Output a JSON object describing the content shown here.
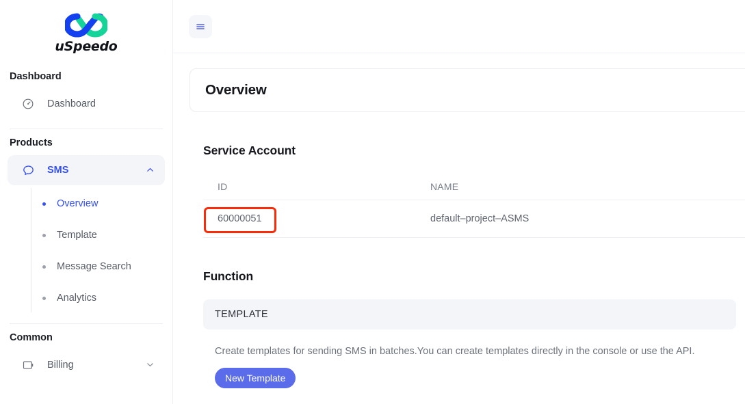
{
  "brand": {
    "name": "uSpeedo",
    "logo_blue": "#1341f0",
    "logo_green": "#14d49a"
  },
  "colors": {
    "accent_blue": "#3550f1",
    "button_blue": "#5a6cea",
    "annotation_red": "#f92b08",
    "active_bg": "#f3f5f9"
  },
  "sidebar": {
    "sections": [
      {
        "title": "Dashboard"
      },
      {
        "title": "Products"
      },
      {
        "title": "Common"
      }
    ],
    "dashboard_item": {
      "label": "Dashboard",
      "icon": "speedometer-icon"
    },
    "sms_item": {
      "label": "SMS",
      "icon": "chat-bubble-icon",
      "chevron": "chevron-up-icon"
    },
    "sms_children": [
      {
        "label": "Overview",
        "active": true
      },
      {
        "label": "Template",
        "active": false
      },
      {
        "label": "Message Search",
        "active": false
      },
      {
        "label": "Analytics",
        "active": false
      }
    ],
    "billing_item": {
      "label": "Billing",
      "icon": "wallet-icon",
      "chevron": "chevron-down-icon"
    }
  },
  "topbar": {
    "menu_icon": "hamburger-menu-icon"
  },
  "page": {
    "title": "Overview"
  },
  "service_account": {
    "heading": "Service Account",
    "columns": [
      "ID",
      "NAME"
    ],
    "rows": [
      {
        "id": "60000051",
        "name": "default–project–ASMS"
      }
    ]
  },
  "function": {
    "heading": "Function",
    "card": {
      "caption": "TEMPLATE",
      "description": "Create templates for sending SMS in batches.You can create templates directly in the console or use the API.",
      "button_label": "New Template"
    }
  }
}
